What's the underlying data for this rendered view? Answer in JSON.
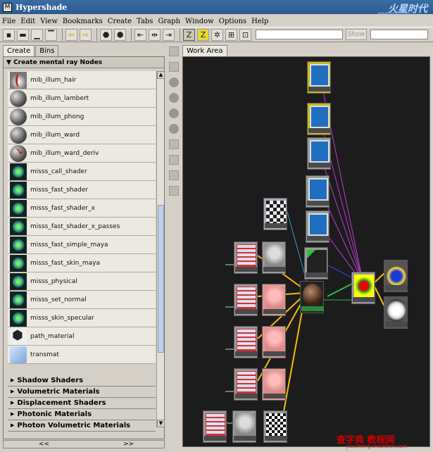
{
  "window": {
    "title": "Hypershade"
  },
  "watermark": {
    "logo": "火星时代",
    "url": "www.hxsd.com.cn",
    "bottom": "查字典 教程网",
    "bottom_url": "jiaocheng.chazidian.com"
  },
  "menu": [
    "File",
    "Edit",
    "View",
    "Bookmarks",
    "Create",
    "Tabs",
    "Graph",
    "Window",
    "Options",
    "Help"
  ],
  "toolbar": {
    "show_label": "Show"
  },
  "left_tabs": [
    "Create",
    "Bins"
  ],
  "section_header": "Create mental ray Nodes",
  "nodes": [
    {
      "label": "mib_illum_hair",
      "icon": "hair"
    },
    {
      "label": "mib_illum_lambert",
      "icon": "sphere"
    },
    {
      "label": "mib_illum_phong",
      "icon": "sphere"
    },
    {
      "label": "mib_illum_ward",
      "icon": "sphere"
    },
    {
      "label": "mib_illum_ward_deriv",
      "icon": "ward"
    },
    {
      "label": "misss_call_shader",
      "icon": "sss"
    },
    {
      "label": "misss_fast_shader",
      "icon": "sss"
    },
    {
      "label": "misss_fast_shader_x",
      "icon": "sss"
    },
    {
      "label": "misss_fast_shader_x_passes",
      "icon": "sss"
    },
    {
      "label": "misss_fast_simple_maya",
      "icon": "sss"
    },
    {
      "label": "misss_fast_skin_maya",
      "icon": "sss"
    },
    {
      "label": "misss_physical",
      "icon": "sss"
    },
    {
      "label": "misss_set_normal",
      "icon": "sss"
    },
    {
      "label": "misss_skin_specular",
      "icon": "sss"
    },
    {
      "label": "path_material",
      "icon": "path"
    },
    {
      "label": "transmat",
      "icon": "trans"
    }
  ],
  "categories": [
    "Shadow Shaders",
    "Volumetric Materials",
    "Displacement Shaders",
    "Photonic Materials",
    "Photon Volumetric Materials"
  ],
  "scroll": {
    "left": "<<",
    "right": ">>"
  },
  "work_tab": "Work Area"
}
